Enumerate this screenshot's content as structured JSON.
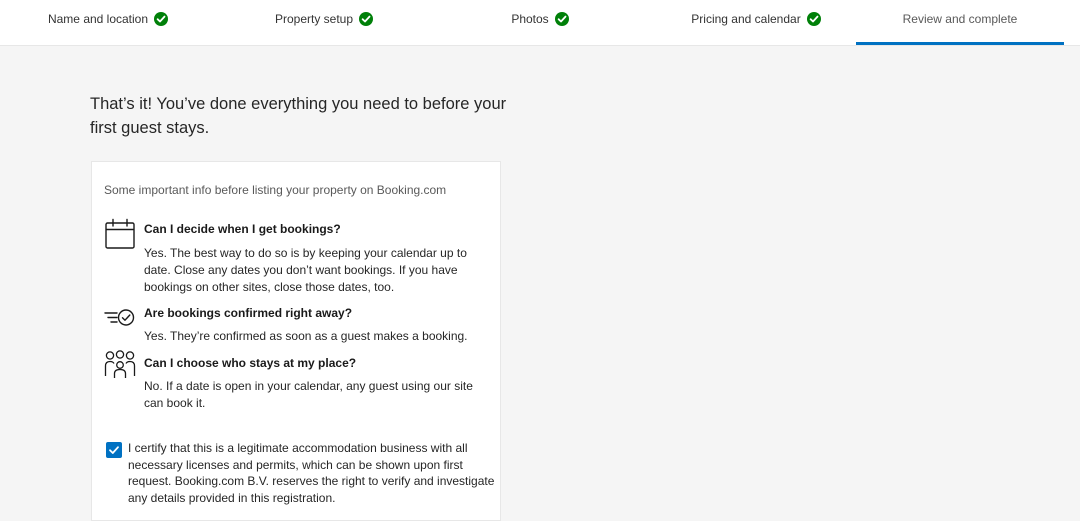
{
  "stepper": {
    "steps": [
      {
        "label": "Name and location",
        "status": "complete"
      },
      {
        "label": "Property setup",
        "status": "complete"
      },
      {
        "label": "Photos",
        "status": "complete"
      },
      {
        "label": "Pricing and calendar",
        "status": "complete"
      },
      {
        "label": "Review and complete",
        "status": "active"
      }
    ]
  },
  "main": {
    "heading": "That’s it! You’ve done everything you need to before your first guest stays.",
    "card": {
      "intro": "Some important info before listing your property on Booking.com",
      "faqs": [
        {
          "icon": "calendar-icon",
          "question": "Can I decide when I get bookings?",
          "answer": "Yes. The best way to do so is by keeping your calendar up to date. Close any dates you don’t want bookings. If you have bookings on other sites, close those dates, too."
        },
        {
          "icon": "fast-confirm-icon",
          "question": "Are bookings confirmed right away?",
          "answer": "Yes. They’re confirmed as soon as a guest makes a booking."
        },
        {
          "icon": "group-icon",
          "question": "Can I choose who stays at my place?",
          "answer": "No. If a date is open in your calendar, any guest using our site can book it."
        }
      ],
      "certify": {
        "checked": true,
        "text": "I certify that this is a legitimate accommodation business with all necessary licenses and permits, which can be shown upon first request. Booking.com B.V. reserves the right to verify and investigate any details provided in this registration."
      }
    }
  },
  "colors": {
    "accent": "#0071c2",
    "success": "#008009",
    "background": "#f5f5f5"
  }
}
